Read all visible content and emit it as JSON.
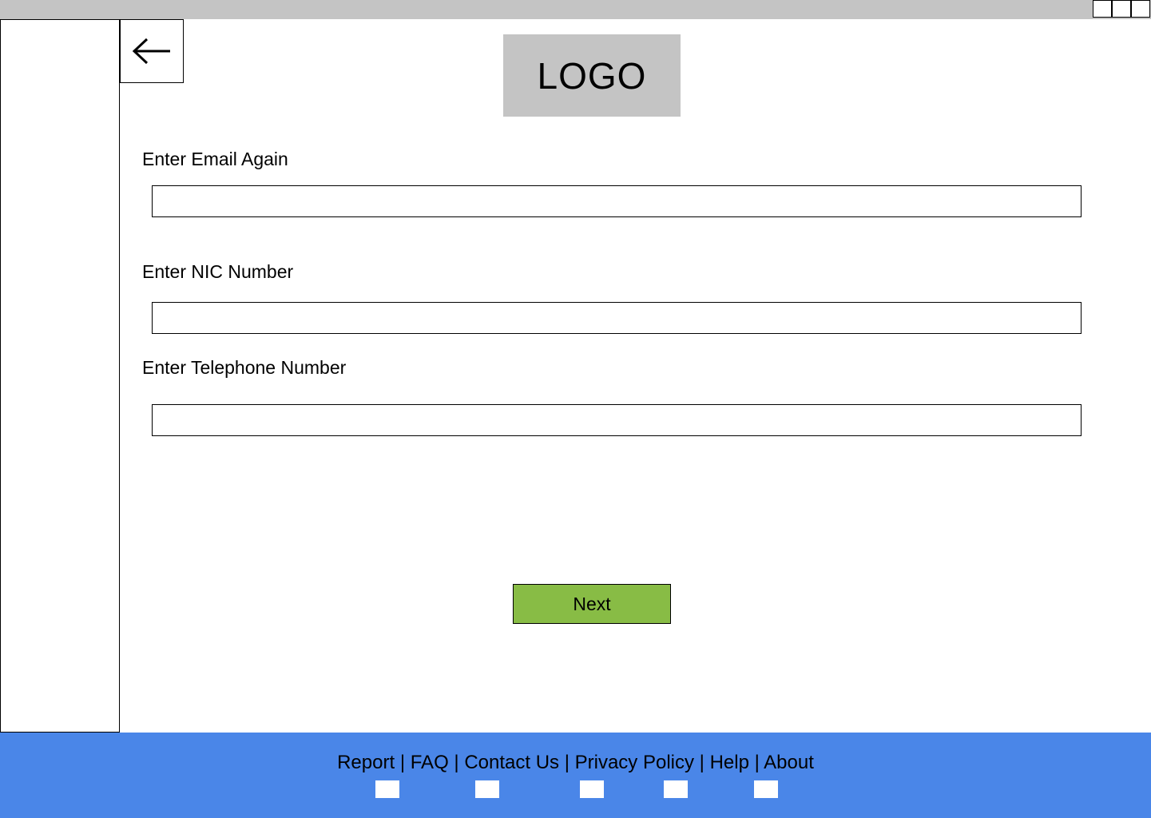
{
  "window": {
    "controls": [
      "minimize",
      "maximize",
      "close"
    ]
  },
  "header": {
    "back_icon": "arrow-left-icon",
    "logo_text": "LOGO"
  },
  "form": {
    "email_label": "Enter Email Again",
    "email_value": "",
    "nic_label": "Enter NIC Number",
    "nic_value": "",
    "telephone_label": "Enter Telephone Number",
    "telephone_value": "",
    "next_label": "Next"
  },
  "footer": {
    "links": [
      "Report",
      "FAQ",
      "Contact Us",
      "Privacy Policy",
      "Help",
      "About"
    ],
    "separator": "|",
    "social_icons": [
      "social-icon-1",
      "social-icon-2",
      "social-icon-3",
      "social-icon-4",
      "social-icon-5"
    ]
  },
  "colors": {
    "titlebar": "#c4c4c4",
    "logo_bg": "#c4c4c4",
    "next_button": "#88bc45",
    "footer_bg": "#4a86e8"
  }
}
